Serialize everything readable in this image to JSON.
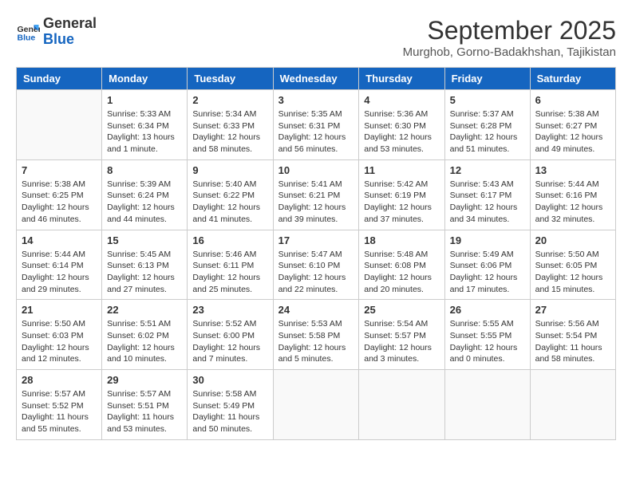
{
  "header": {
    "logo_general": "General",
    "logo_blue": "Blue",
    "month_year": "September 2025",
    "location": "Murghob, Gorno-Badakhshan, Tajikistan"
  },
  "days_of_week": [
    "Sunday",
    "Monday",
    "Tuesday",
    "Wednesday",
    "Thursday",
    "Friday",
    "Saturday"
  ],
  "weeks": [
    [
      {
        "day": "",
        "content": ""
      },
      {
        "day": "1",
        "content": "Sunrise: 5:33 AM\nSunset: 6:34 PM\nDaylight: 13 hours\nand 1 minute."
      },
      {
        "day": "2",
        "content": "Sunrise: 5:34 AM\nSunset: 6:33 PM\nDaylight: 12 hours\nand 58 minutes."
      },
      {
        "day": "3",
        "content": "Sunrise: 5:35 AM\nSunset: 6:31 PM\nDaylight: 12 hours\nand 56 minutes."
      },
      {
        "day": "4",
        "content": "Sunrise: 5:36 AM\nSunset: 6:30 PM\nDaylight: 12 hours\nand 53 minutes."
      },
      {
        "day": "5",
        "content": "Sunrise: 5:37 AM\nSunset: 6:28 PM\nDaylight: 12 hours\nand 51 minutes."
      },
      {
        "day": "6",
        "content": "Sunrise: 5:38 AM\nSunset: 6:27 PM\nDaylight: 12 hours\nand 49 minutes."
      }
    ],
    [
      {
        "day": "7",
        "content": "Sunrise: 5:38 AM\nSunset: 6:25 PM\nDaylight: 12 hours\nand 46 minutes."
      },
      {
        "day": "8",
        "content": "Sunrise: 5:39 AM\nSunset: 6:24 PM\nDaylight: 12 hours\nand 44 minutes."
      },
      {
        "day": "9",
        "content": "Sunrise: 5:40 AM\nSunset: 6:22 PM\nDaylight: 12 hours\nand 41 minutes."
      },
      {
        "day": "10",
        "content": "Sunrise: 5:41 AM\nSunset: 6:21 PM\nDaylight: 12 hours\nand 39 minutes."
      },
      {
        "day": "11",
        "content": "Sunrise: 5:42 AM\nSunset: 6:19 PM\nDaylight: 12 hours\nand 37 minutes."
      },
      {
        "day": "12",
        "content": "Sunrise: 5:43 AM\nSunset: 6:17 PM\nDaylight: 12 hours\nand 34 minutes."
      },
      {
        "day": "13",
        "content": "Sunrise: 5:44 AM\nSunset: 6:16 PM\nDaylight: 12 hours\nand 32 minutes."
      }
    ],
    [
      {
        "day": "14",
        "content": "Sunrise: 5:44 AM\nSunset: 6:14 PM\nDaylight: 12 hours\nand 29 minutes."
      },
      {
        "day": "15",
        "content": "Sunrise: 5:45 AM\nSunset: 6:13 PM\nDaylight: 12 hours\nand 27 minutes."
      },
      {
        "day": "16",
        "content": "Sunrise: 5:46 AM\nSunset: 6:11 PM\nDaylight: 12 hours\nand 25 minutes."
      },
      {
        "day": "17",
        "content": "Sunrise: 5:47 AM\nSunset: 6:10 PM\nDaylight: 12 hours\nand 22 minutes."
      },
      {
        "day": "18",
        "content": "Sunrise: 5:48 AM\nSunset: 6:08 PM\nDaylight: 12 hours\nand 20 minutes."
      },
      {
        "day": "19",
        "content": "Sunrise: 5:49 AM\nSunset: 6:06 PM\nDaylight: 12 hours\nand 17 minutes."
      },
      {
        "day": "20",
        "content": "Sunrise: 5:50 AM\nSunset: 6:05 PM\nDaylight: 12 hours\nand 15 minutes."
      }
    ],
    [
      {
        "day": "21",
        "content": "Sunrise: 5:50 AM\nSunset: 6:03 PM\nDaylight: 12 hours\nand 12 minutes."
      },
      {
        "day": "22",
        "content": "Sunrise: 5:51 AM\nSunset: 6:02 PM\nDaylight: 12 hours\nand 10 minutes."
      },
      {
        "day": "23",
        "content": "Sunrise: 5:52 AM\nSunset: 6:00 PM\nDaylight: 12 hours\nand 7 minutes."
      },
      {
        "day": "24",
        "content": "Sunrise: 5:53 AM\nSunset: 5:58 PM\nDaylight: 12 hours\nand 5 minutes."
      },
      {
        "day": "25",
        "content": "Sunrise: 5:54 AM\nSunset: 5:57 PM\nDaylight: 12 hours\nand 3 minutes."
      },
      {
        "day": "26",
        "content": "Sunrise: 5:55 AM\nSunset: 5:55 PM\nDaylight: 12 hours\nand 0 minutes."
      },
      {
        "day": "27",
        "content": "Sunrise: 5:56 AM\nSunset: 5:54 PM\nDaylight: 11 hours\nand 58 minutes."
      }
    ],
    [
      {
        "day": "28",
        "content": "Sunrise: 5:57 AM\nSunset: 5:52 PM\nDaylight: 11 hours\nand 55 minutes."
      },
      {
        "day": "29",
        "content": "Sunrise: 5:57 AM\nSunset: 5:51 PM\nDaylight: 11 hours\nand 53 minutes."
      },
      {
        "day": "30",
        "content": "Sunrise: 5:58 AM\nSunset: 5:49 PM\nDaylight: 11 hours\nand 50 minutes."
      },
      {
        "day": "",
        "content": ""
      },
      {
        "day": "",
        "content": ""
      },
      {
        "day": "",
        "content": ""
      },
      {
        "day": "",
        "content": ""
      }
    ]
  ]
}
